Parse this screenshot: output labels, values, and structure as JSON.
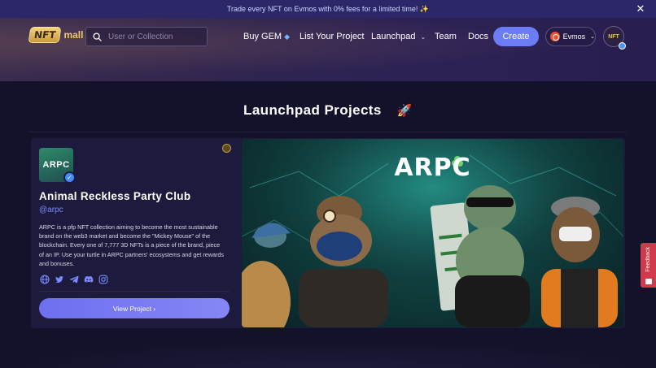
{
  "banner": {
    "text": "Trade every NFT on Evmos with 0% fees for a limited time! ✨"
  },
  "header": {
    "logo_badge": "NFT",
    "logo_text": "mall",
    "search_placeholder": "User or Collection",
    "nav": {
      "buy_gem": "Buy GEM",
      "list_project": "List Your Project",
      "launchpad": "Launchpad",
      "team": "Team",
      "docs": "Docs"
    },
    "create_label": "Create",
    "chain_label": "Evmos",
    "avatar_label": "NFT"
  },
  "page": {
    "title": "Launchpad Projects",
    "title_emoji": "🚀"
  },
  "project": {
    "logo_text": "ARPC",
    "name": "Animal Reckless Party Club",
    "handle": "@arpc",
    "description": "ARPC is a pfp NFT collection aiming to become the most sustainable brand on the web3 market and become the \"Mickey Mouse\" of the blockchain. Every one of 7,777 3D NFTs is a piece of the brand, piece of an IP. Use your turtle in ARPC partners' ecosystems and get rewards and bonuses.",
    "socials": [
      "globe-icon",
      "twitter-icon",
      "telegram-icon",
      "discord-icon",
      "instagram-icon"
    ],
    "view_button": "View Project ›",
    "hero_title": "ARPC"
  },
  "feedback_label": "Feedback",
  "colors": {
    "accent": "#6b7cf5",
    "handle": "#7a8bff",
    "banner_bg": "#2b2768",
    "card_bg": "#1d1b3d",
    "feedback": "#d03a4a"
  }
}
